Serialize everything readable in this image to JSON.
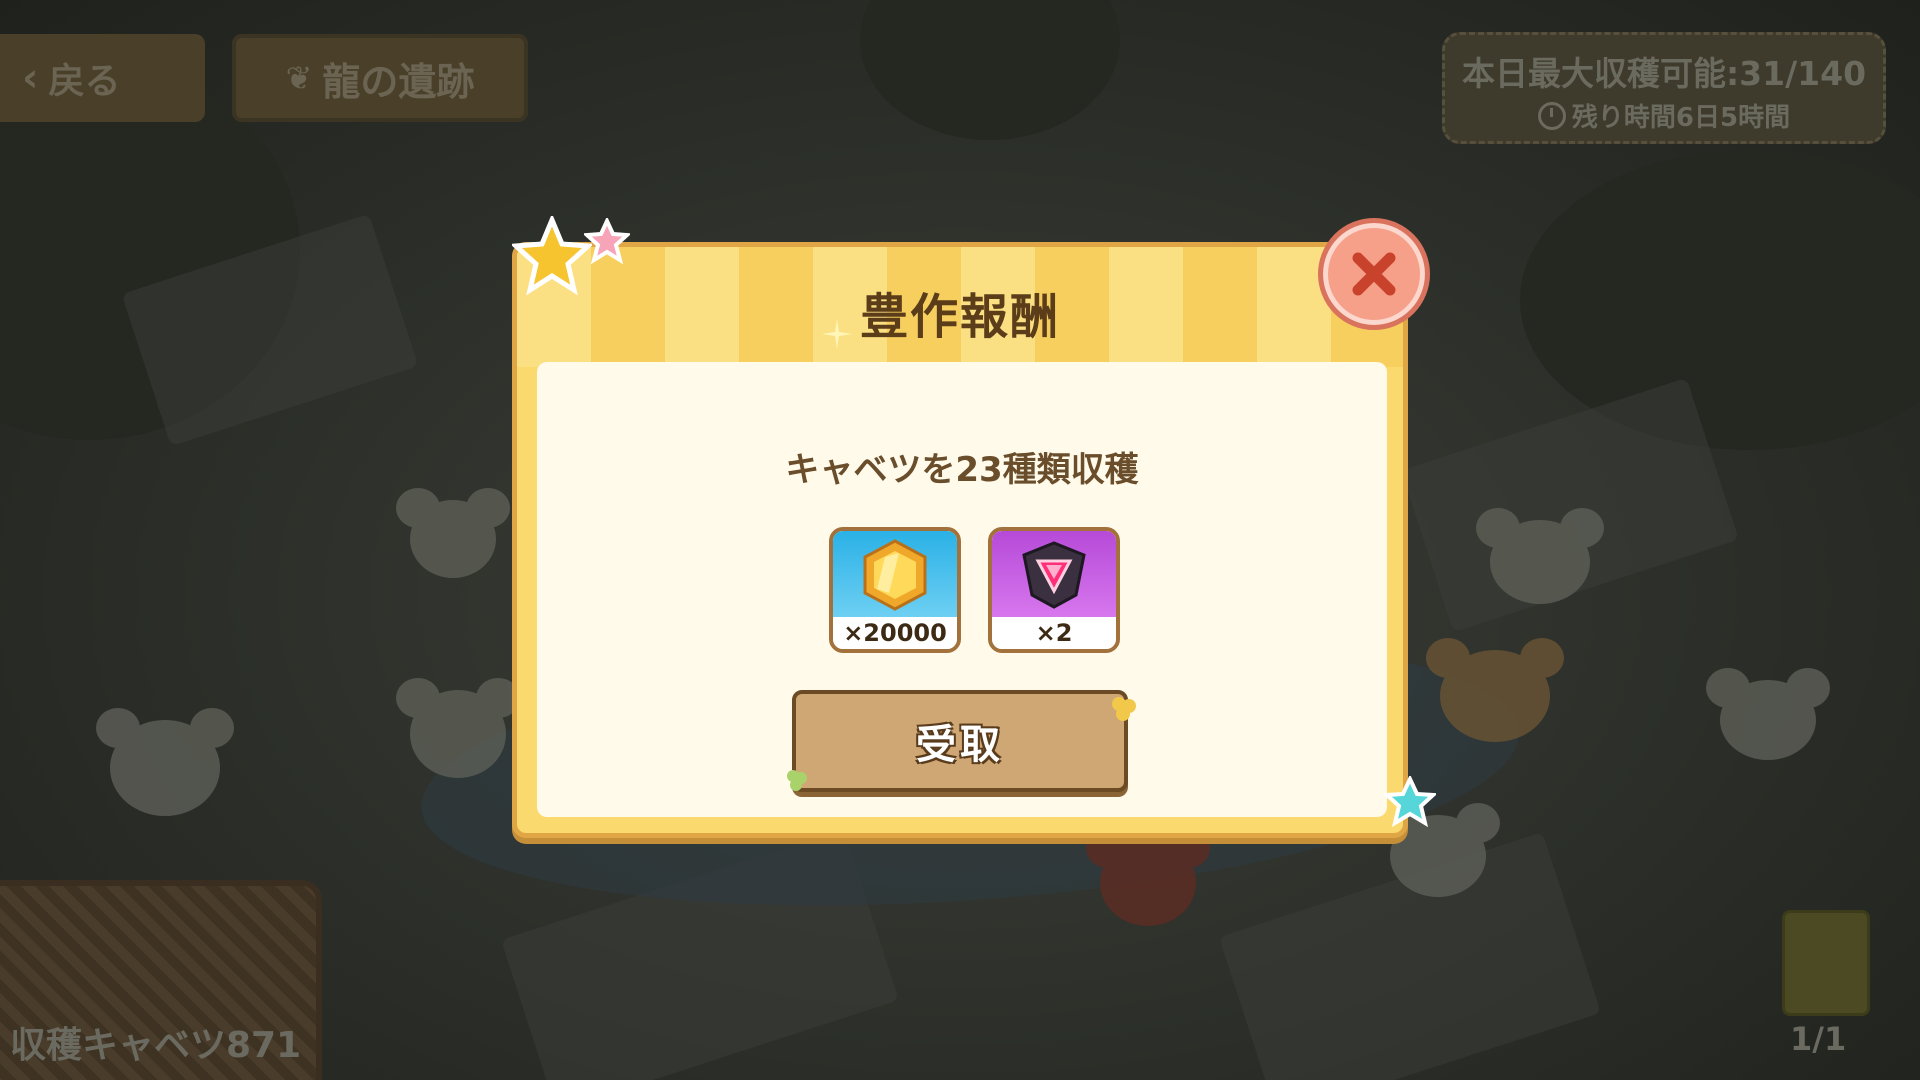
{
  "topbar": {
    "back_label": "戻る",
    "location_title": "龍の遺跡"
  },
  "harvest_info": {
    "daily_limit": "本日最大収穫可能:31/140",
    "time_remaining": "残り時間6日5時間"
  },
  "footer": {
    "harvest_count": "収穫キャベツ871",
    "page_indicator": "1/1"
  },
  "modal": {
    "title": "豊作報酬",
    "message": "キャベツを23種類収穫",
    "rewards": [
      {
        "icon": "gold-coin-icon",
        "quantity": "×20000"
      },
      {
        "icon": "crystal-core-icon",
        "quantity": "×2"
      }
    ],
    "receive_label": "受取"
  },
  "colors": {
    "modal_frame": "#fad96e",
    "modal_body": "#fffaea",
    "button_wood": "#cfa774",
    "close_button": "#f6a08a",
    "title_text": "#5b3d1a"
  }
}
